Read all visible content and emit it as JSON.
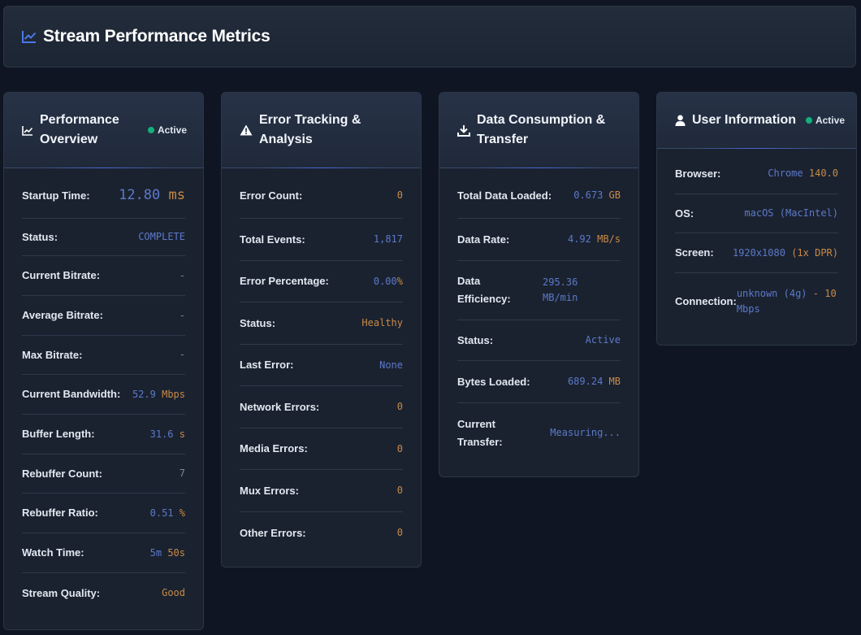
{
  "header": {
    "title": "Stream Performance Metrics",
    "icon": "chart-line-icon"
  },
  "colors": {
    "value_blue": "#5d79c9",
    "unit_orange": "#c98a45",
    "status_green": "#13b07a",
    "accent": "#4b6ad8"
  },
  "performance": {
    "title_line1": "Performance",
    "title_line2": "Overview",
    "badge": "Active",
    "rows": [
      {
        "label": "Startup Time:",
        "num": "12.80",
        "unit": "ms"
      },
      {
        "label": "Status:",
        "num": "COMPLETE"
      },
      {
        "label": "Current Bitrate:",
        "dim": "-"
      },
      {
        "label": "Average Bitrate:",
        "dim": "-"
      },
      {
        "label": "Max Bitrate:",
        "dim": "-"
      },
      {
        "label": "Current Bandwidth:",
        "num": "52.9",
        "unit": "Mbps"
      },
      {
        "label": "Buffer Length:",
        "num": "31.6",
        "unit": "s"
      },
      {
        "label": "Rebuffer Count:",
        "dim": "7"
      },
      {
        "label": "Rebuffer Ratio:",
        "num": "0.51",
        "unit": "%"
      },
      {
        "label": "Watch Time:",
        "num": "5m",
        "unit": "50s"
      },
      {
        "label": "Stream Quality:",
        "unit": "Good"
      }
    ]
  },
  "errors": {
    "title_line1": "Error Tracking &",
    "title_line2": "Analysis",
    "rows": [
      {
        "label": "Error Count:",
        "unit": "0"
      },
      {
        "label": "Total Events:",
        "num": "1,817"
      },
      {
        "label": "Error Percentage:",
        "num": "0.00",
        "unit": "%"
      },
      {
        "label": "Status:",
        "unit": "Healthy"
      },
      {
        "label": "Last Error:",
        "num": "None"
      },
      {
        "label": "Network Errors:",
        "unit": "0"
      },
      {
        "label": "Media Errors:",
        "unit": "0"
      },
      {
        "label": "Mux Errors:",
        "unit": "0"
      },
      {
        "label": "Other Errors:",
        "unit": "0"
      }
    ]
  },
  "data": {
    "title_line1": "Data Consumption &",
    "title_line2": "Transfer",
    "rows": [
      {
        "label": "Total Data Loaded:",
        "num": "0.673",
        "unit": "GB"
      },
      {
        "label": "Data Rate:",
        "num": "4.92",
        "unit": "MB/s"
      },
      {
        "label1": "Data",
        "label2": "Efficiency:",
        "num1": "295.36",
        "num2": "MB/min"
      },
      {
        "label": "Status:",
        "num": "Active"
      },
      {
        "label": "Bytes Loaded:",
        "num": "689.24",
        "unit": "MB"
      },
      {
        "label1": "Current",
        "label2": "Transfer:",
        "num": "Measuring..."
      }
    ]
  },
  "user": {
    "title": "User Information",
    "badge": "Active",
    "rows": [
      {
        "label": "Browser:",
        "num": "Chrome",
        "unit": "140.0"
      },
      {
        "label": "OS:",
        "num": "macOS (MacIntel)"
      },
      {
        "label": "Screen:",
        "num": "1920x1080",
        "unit": "(1x DPR)"
      },
      {
        "label": "Connection:",
        "num1": "unknown (4g)",
        "unit1": "- 10",
        "num2": "Mbps"
      }
    ]
  }
}
